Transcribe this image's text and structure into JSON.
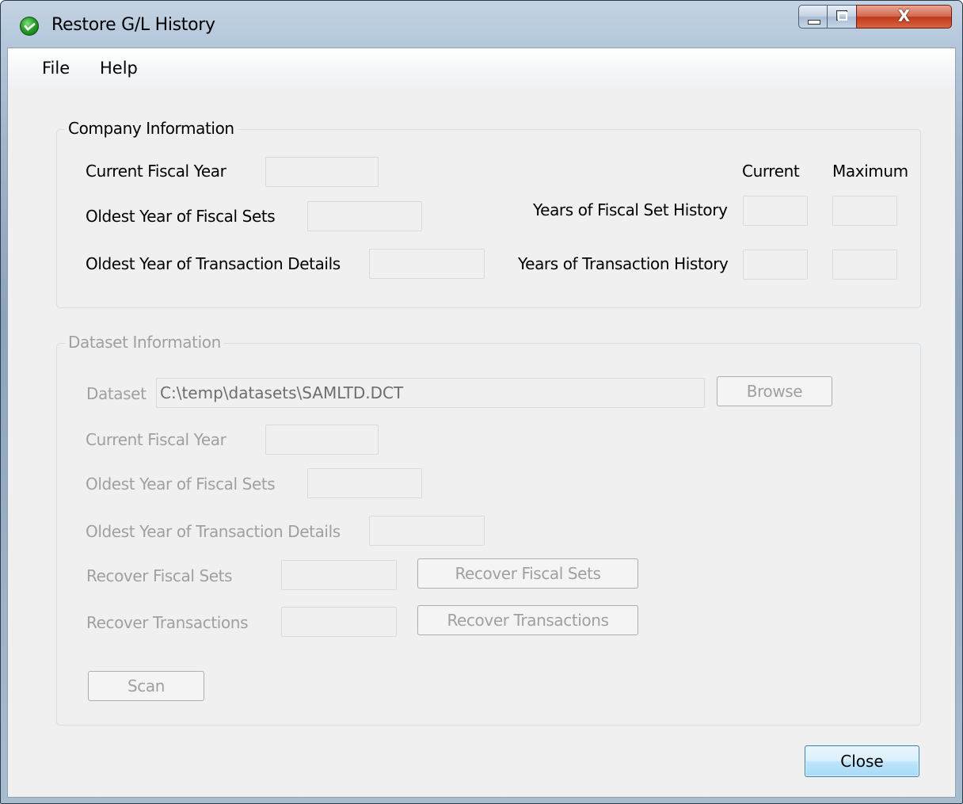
{
  "window": {
    "title": "Restore G/L History"
  },
  "title_controls": {
    "minimize": "minimize",
    "maximize": "maximize",
    "close_glyph": "X"
  },
  "menu": {
    "file": "File",
    "help": "Help"
  },
  "company": {
    "legend": "Company Information",
    "current_fiscal_year_label": "Current Fiscal Year",
    "oldest_fiscal_sets_label": "Oldest Year of Fiscal Sets",
    "oldest_transaction_details_label": "Oldest Year of Transaction Details",
    "col_current": "Current",
    "col_maximum": "Maximum",
    "years_fiscal_set_history_label": "Years of Fiscal Set History",
    "years_transaction_history_label": "Years of Transaction History",
    "values": {
      "current_fiscal_year": "",
      "oldest_fiscal_sets": "",
      "oldest_transaction_details": "",
      "fiscal_set_history_current": "",
      "fiscal_set_history_maximum": "",
      "transaction_history_current": "",
      "transaction_history_maximum": ""
    }
  },
  "dataset": {
    "legend": "Dataset Information",
    "dataset_label": "Dataset",
    "dataset_path": "C:\\temp\\datasets\\SAMLTD.DCT",
    "browse_button": "Browse",
    "current_fiscal_year_label": "Current Fiscal Year",
    "oldest_fiscal_sets_label": "Oldest Year of Fiscal Sets",
    "oldest_transaction_details_label": "Oldest Year of Transaction Details",
    "recover_fiscal_sets_label": "Recover Fiscal Sets",
    "recover_fiscal_sets_button": "Recover Fiscal Sets",
    "recover_transactions_label": "Recover Transactions",
    "recover_transactions_button": "Recover Transactions",
    "scan_button": "Scan",
    "values": {
      "current_fiscal_year": "",
      "oldest_fiscal_sets": "",
      "oldest_transaction_details": "",
      "recover_fiscal_sets": "",
      "recover_transactions": ""
    }
  },
  "footer": {
    "close_button": "Close"
  },
  "colors": {
    "disabled_text": "#a0a0a0",
    "client_bg": "#f0f0f0",
    "accent_border": "#3c7fb1"
  }
}
